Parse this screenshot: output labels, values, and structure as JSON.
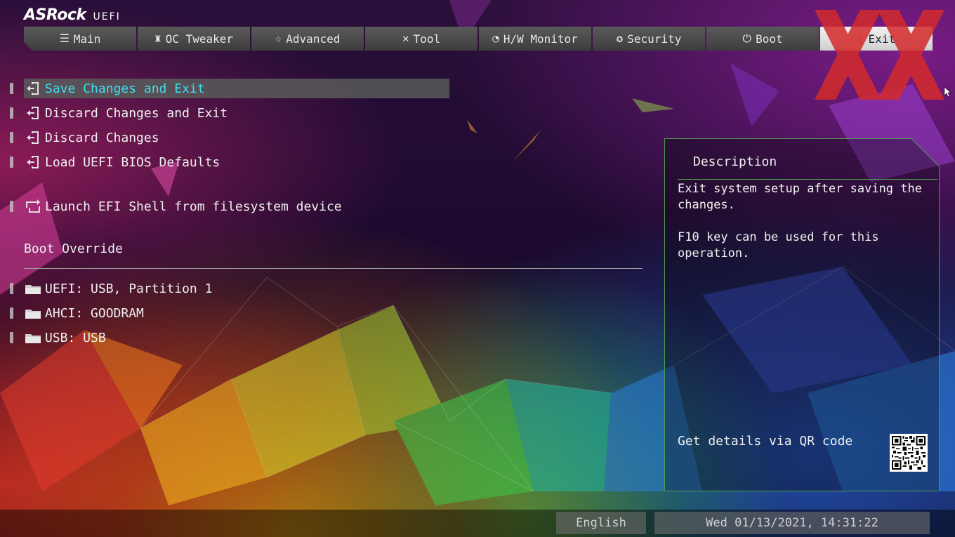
{
  "header": {
    "brand": "ASRock",
    "sub": "UEFI"
  },
  "tabs": [
    {
      "label": "Main",
      "icon": "list-icon"
    },
    {
      "label": "OC Tweaker",
      "icon": "rocket-icon"
    },
    {
      "label": "Advanced",
      "icon": "star-icon"
    },
    {
      "label": "Tool",
      "icon": "tools-icon"
    },
    {
      "label": "H/W Monitor",
      "icon": "monitor-gauge-icon"
    },
    {
      "label": "Security",
      "icon": "shield-gear-icon"
    },
    {
      "label": "Boot",
      "icon": "power-icon"
    },
    {
      "label": "Exit",
      "icon": "exit-door-icon"
    }
  ],
  "active_tab": "Exit",
  "menu": {
    "items": [
      {
        "label": "Save Changes and Exit",
        "icon": "exit-door-icon",
        "selected": true
      },
      {
        "label": "Discard Changes and Exit",
        "icon": "exit-door-icon"
      },
      {
        "label": "Discard Changes",
        "icon": "exit-door-icon"
      },
      {
        "label": "Load UEFI BIOS Defaults",
        "icon": "exit-door-icon"
      },
      {
        "label": "Launch EFI Shell from filesystem device",
        "icon": "shell-loop-icon"
      }
    ],
    "boot_override_title": "Boot Override",
    "boot_items": [
      {
        "label": "UEFI:  USB, Partition 1",
        "icon": "folder-icon"
      },
      {
        "label": "AHCI:  GOODRAM",
        "icon": "folder-icon"
      },
      {
        "label": "USB:  USB",
        "icon": "folder-icon"
      }
    ]
  },
  "description": {
    "title": "Description",
    "body": "Exit system setup after saving the\nchanges.\n\nF10 key can be used for this\noperation.",
    "qr_label": "Get details via QR code"
  },
  "footer": {
    "language": "English",
    "datetime": "Wed 01/13/2021, 14:31:22"
  },
  "colors": {
    "selected_text": "#3ee0f0",
    "panel_border": "#4f9c4f",
    "exit_mark": "#d42a2a"
  }
}
